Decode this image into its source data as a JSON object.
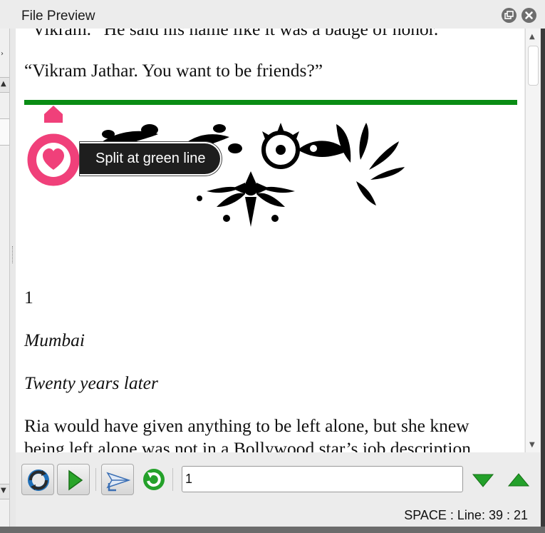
{
  "window": {
    "title": "File Preview"
  },
  "preview": {
    "lines": [
      "“Vikram.” He said his name like it was a badge of honor.",
      "“Vikram Jathar. You want to be friends?”"
    ],
    "chapter_number": "1",
    "place": "Mumbai",
    "time": "Twenty years later",
    "paragraph_lines": [
      "Ria would have given anything to be left alone, but she knew",
      "being left alone was not in a Bollywood star’s job description."
    ],
    "marker_color": "#0a8c14"
  },
  "callout": {
    "text": "Split at green line",
    "icon": "heart-icon",
    "color": "#f0407a"
  },
  "toolbar": {
    "buttons": [
      {
        "icon": "sync-icon"
      },
      {
        "icon": "play-icon"
      },
      {
        "icon": "send-icon"
      },
      {
        "icon": "refresh-icon"
      }
    ],
    "search_value": "1",
    "next_icon": "arrow-down-icon",
    "prev_icon": "arrow-up-icon"
  },
  "status": {
    "text": "SPACE : Line: 39 : 21"
  }
}
